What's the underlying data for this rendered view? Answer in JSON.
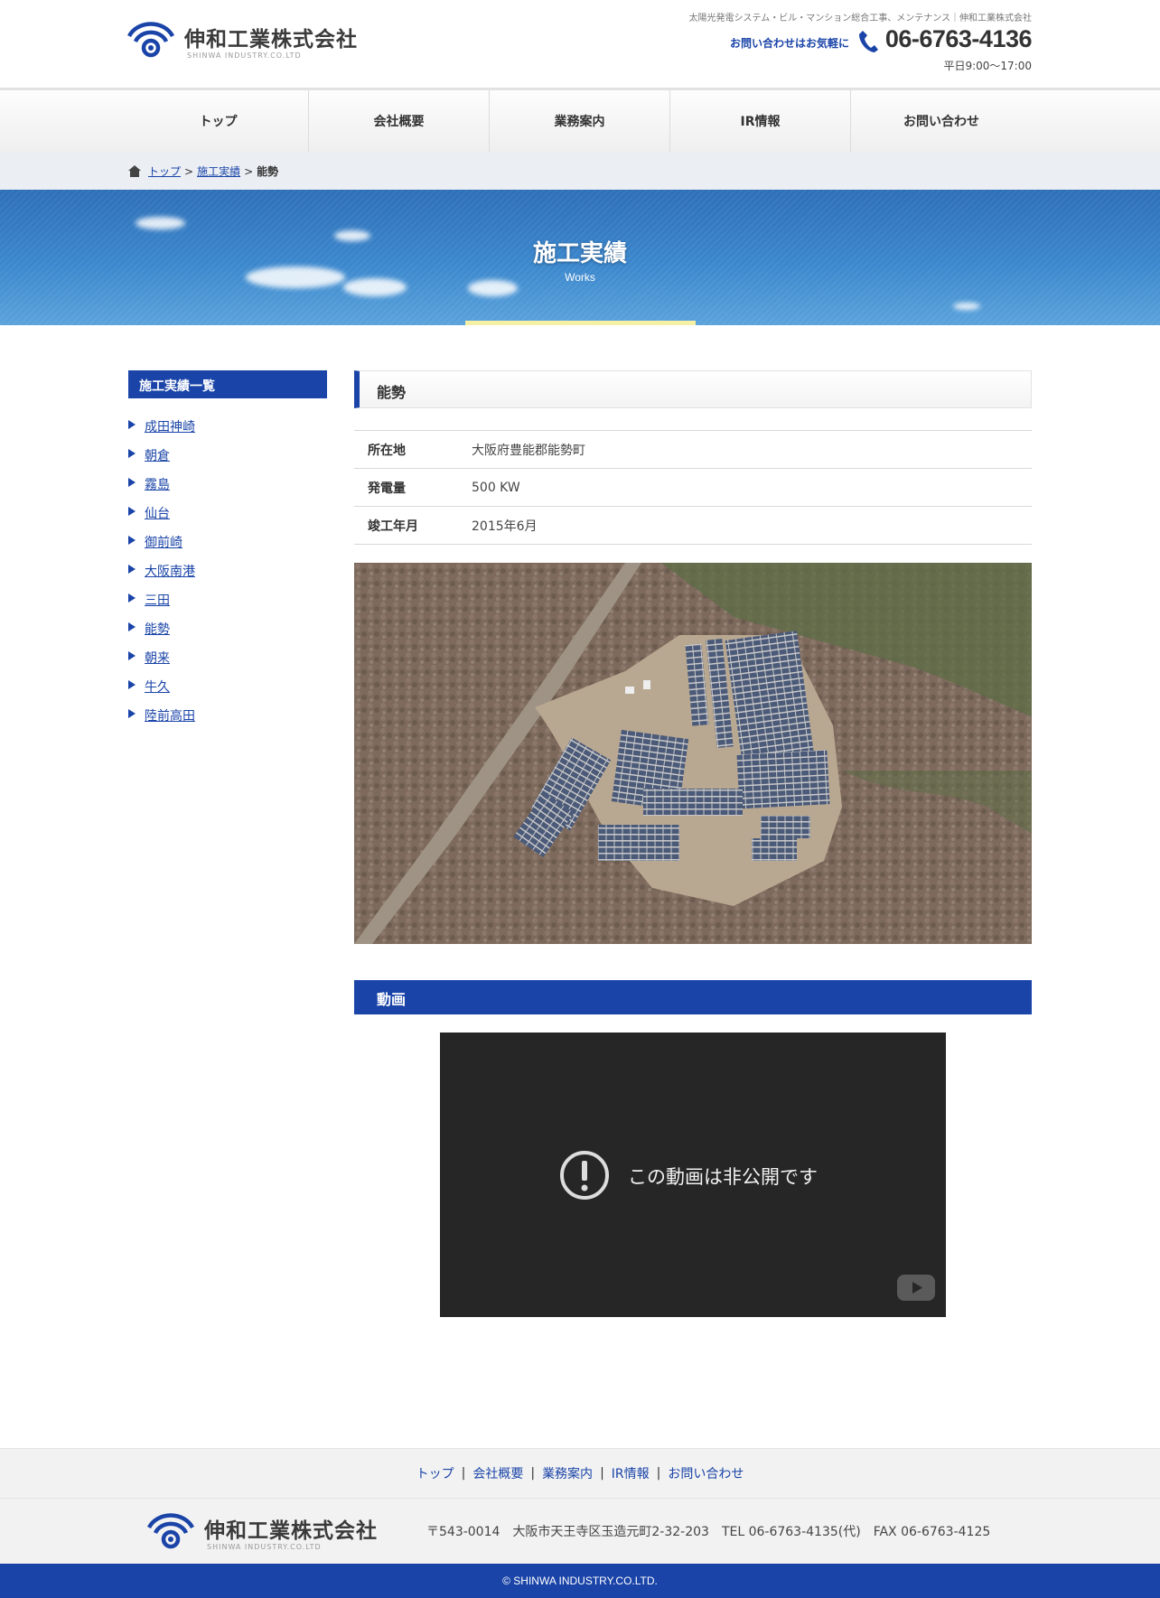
{
  "header": {
    "company_name": "伸和工業株式会社",
    "company_sub": "SHINWA INDUSTRY.CO.LTD",
    "tagline": "太陽光発電システム・ビル・マンション総合工事、メンテナンス｜伸和工業株式会社",
    "contact_lead": "お問い合わせはお気軽に",
    "phone": "06-6763-4136",
    "hours": "平日9:00～17:00",
    "icons": [
      "logo-mark-icon",
      "phone-icon"
    ]
  },
  "nav": {
    "items": [
      {
        "label": "トップ"
      },
      {
        "label": "会社概要"
      },
      {
        "label": "業務案内"
      },
      {
        "label": "IR情報"
      },
      {
        "label": "お問い合わせ"
      }
    ]
  },
  "breadcrumb": {
    "home": "トップ",
    "parent": "施工実績",
    "current": "能勢",
    "separator": ">"
  },
  "hero": {
    "title": "施工実績",
    "subtitle": "Works"
  },
  "sidebar": {
    "heading": "施工実績一覧",
    "items": [
      {
        "label": "成田神崎"
      },
      {
        "label": "朝倉"
      },
      {
        "label": "霧島"
      },
      {
        "label": "仙台"
      },
      {
        "label": "御前崎"
      },
      {
        "label": "大阪南港"
      },
      {
        "label": "三田"
      },
      {
        "label": "能勢"
      },
      {
        "label": "朝来"
      },
      {
        "label": "牛久"
      },
      {
        "label": "陸前高田"
      }
    ]
  },
  "main": {
    "title": "能勢",
    "spec": [
      {
        "label": "所在地",
        "value": "大阪府豊能郡能勢町"
      },
      {
        "label": "発電量",
        "value": "500 KW"
      },
      {
        "label": "竣工年月",
        "value": "2015年6月"
      }
    ],
    "video_heading": "動画",
    "video_message": "この動画は非公開です"
  },
  "footer": {
    "nav": [
      {
        "label": "トップ"
      },
      {
        "label": "会社概要"
      },
      {
        "label": "業務案内"
      },
      {
        "label": "IR情報"
      },
      {
        "label": "お問い合わせ"
      }
    ],
    "nav_separator": "|",
    "company_name": "伸和工業株式会社",
    "company_sub": "SHINWA INDUSTRY.CO.LTD",
    "address": "〒543-0014　大阪市天王寺区玉造元町2-32-203　TEL 06-6763-4135(代)　FAX 06-6763-4125",
    "copyright": "© SHINWA INDUSTRY.CO.LTD."
  },
  "colors": {
    "brand_blue": "#1a44a8",
    "hero_sky": "#3b87cd",
    "hero_accent": "#f5f0a6",
    "video_bg": "#262626"
  }
}
